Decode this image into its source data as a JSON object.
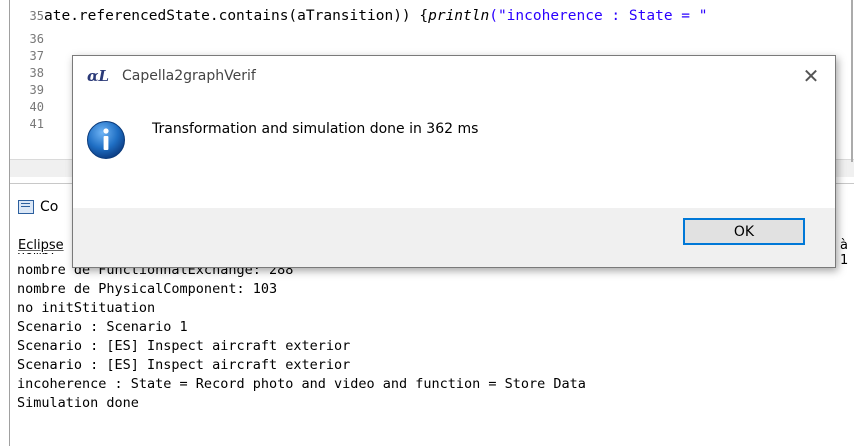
{
  "editor": {
    "lines": [
      {
        "num": "35",
        "code_pre": "ate.referencedState.contains(aTransition)) {",
        "code_kw": "println",
        "code_str": "(\"incoherence : State = \""
      },
      {
        "num": "36"
      },
      {
        "num": "37"
      },
      {
        "num": "38"
      },
      {
        "num": "39"
      },
      {
        "num": "40"
      },
      {
        "num": "41"
      }
    ]
  },
  "console": {
    "tab_label": "Co",
    "description_left": "Eclipse",
    "description_right": "à 1",
    "output": [
      "nombre de FunctionnalExchange: 288",
      "nombre de PhysicalComponent: 103",
      "no initStituation",
      "Scenario : Scenario 1",
      "Scenario : [ES] Inspect aircraft exterior",
      "Scenario : [ES] Inspect aircraft exterior",
      "incoherence : State = Record photo and video and function = Store Data",
      "Simulation done"
    ],
    "clipped_top_line": "nombr"
  },
  "dialog": {
    "logo": "αL",
    "title": "Capella2graphVerif",
    "close_glyph": "✕",
    "message": "Transformation and simulation done in 362 ms",
    "icon": "information-icon",
    "ok_label": "OK"
  },
  "colors": {
    "accent": "#0078d7",
    "string": "#2a00ff",
    "info_icon": "#1f6fc4"
  }
}
